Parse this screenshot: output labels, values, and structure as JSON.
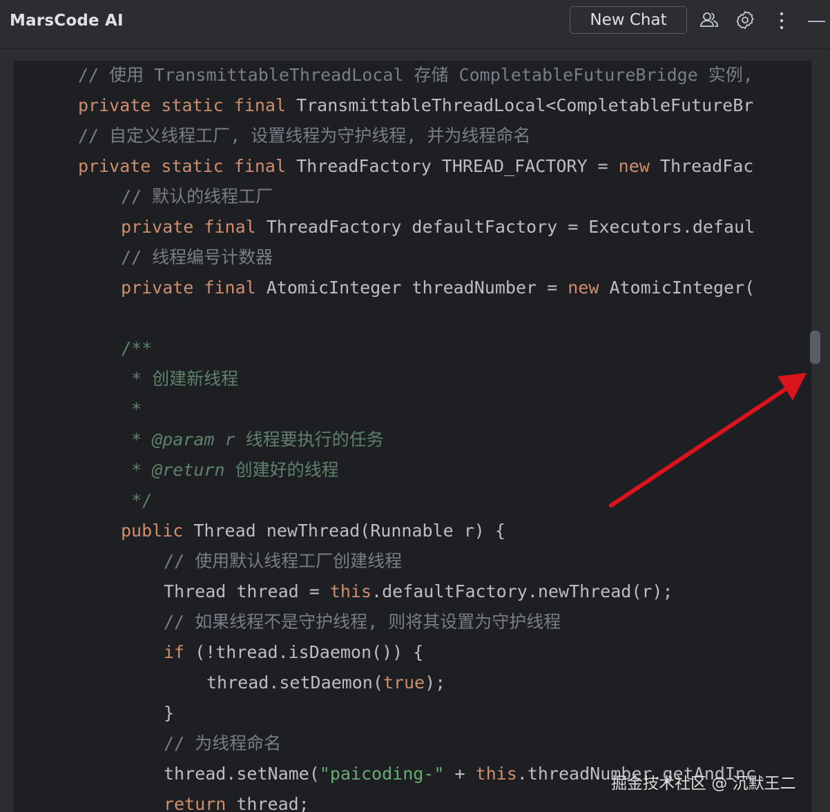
{
  "header": {
    "title": "MarsCode AI",
    "new_chat_label": "New Chat",
    "icons": [
      "users-icon",
      "gear-icon",
      "more-vertical-icon",
      "minimize-icon"
    ]
  },
  "colors": {
    "keyword": "#cf8e6d",
    "comment": "#7a7e85",
    "doc_comment": "#5f826b",
    "string": "#6aab73",
    "plain": "#bcbec4",
    "editor_bg": "#1e1f22",
    "panel_bg": "#2b2d30",
    "arrow": "#d9141c"
  },
  "code": {
    "lines": [
      {
        "indent": 0,
        "tokens": [
          {
            "c": "cm",
            "t": "// 使用 TransmittableThreadLocal 存储 CompletableFutureBridge 实例,"
          }
        ]
      },
      {
        "indent": 0,
        "tokens": [
          {
            "c": "kw",
            "t": "private static final "
          },
          {
            "c": "pl",
            "t": "TransmittableThreadLocal<CompletableFutureBr"
          }
        ]
      },
      {
        "indent": 0,
        "tokens": [
          {
            "c": "cm",
            "t": "// 自定义线程工厂, 设置线程为守护线程, 并为线程命名"
          }
        ]
      },
      {
        "indent": 0,
        "tokens": [
          {
            "c": "kw",
            "t": "private static final "
          },
          {
            "c": "pl",
            "t": "ThreadFactory THREAD_FACTORY = "
          },
          {
            "c": "kw",
            "t": "new "
          },
          {
            "c": "pl",
            "t": "ThreadFac"
          }
        ]
      },
      {
        "indent": 1,
        "tokens": [
          {
            "c": "cm",
            "t": "// 默认的线程工厂"
          }
        ]
      },
      {
        "indent": 1,
        "tokens": [
          {
            "c": "kw",
            "t": "private final "
          },
          {
            "c": "pl",
            "t": "ThreadFactory defaultFactory = Executors.defaul"
          }
        ]
      },
      {
        "indent": 1,
        "tokens": [
          {
            "c": "cm",
            "t": "// 线程编号计数器"
          }
        ]
      },
      {
        "indent": 1,
        "tokens": [
          {
            "c": "kw",
            "t": "private final "
          },
          {
            "c": "pl",
            "t": "AtomicInteger threadNumber = "
          },
          {
            "c": "kw",
            "t": "new "
          },
          {
            "c": "pl",
            "t": "AtomicInteger("
          }
        ]
      },
      {
        "indent": 1,
        "tokens": []
      },
      {
        "indent": 1,
        "tokens": [
          {
            "c": "doc",
            "t": "/**"
          }
        ]
      },
      {
        "indent": 1,
        "tokens": [
          {
            "c": "doc",
            "t": " * 创建新线程"
          }
        ]
      },
      {
        "indent": 1,
        "tokens": [
          {
            "c": "doc",
            "t": " *"
          }
        ]
      },
      {
        "indent": 1,
        "tokens": [
          {
            "c": "doc",
            "t": " * "
          },
          {
            "c": "tag",
            "t": "@param"
          },
          {
            "c": "doc",
            "t": " "
          },
          {
            "c": "prm",
            "t": "r"
          },
          {
            "c": "doc",
            "t": " 线程要执行的任务"
          }
        ]
      },
      {
        "indent": 1,
        "tokens": [
          {
            "c": "doc",
            "t": " * "
          },
          {
            "c": "tag",
            "t": "@return"
          },
          {
            "c": "doc",
            "t": " 创建好的线程"
          }
        ]
      },
      {
        "indent": 1,
        "tokens": [
          {
            "c": "doc",
            "t": " */"
          }
        ]
      },
      {
        "indent": 1,
        "tokens": [
          {
            "c": "kw",
            "t": "public "
          },
          {
            "c": "pl",
            "t": "Thread newThread(Runnable r) {"
          }
        ]
      },
      {
        "indent": 2,
        "tokens": [
          {
            "c": "cm",
            "t": "// 使用默认线程工厂创建线程"
          }
        ]
      },
      {
        "indent": 2,
        "tokens": [
          {
            "c": "pl",
            "t": "Thread thread = "
          },
          {
            "c": "kw",
            "t": "this"
          },
          {
            "c": "pl",
            "t": ".defaultFactory.newThread(r);"
          }
        ]
      },
      {
        "indent": 2,
        "tokens": [
          {
            "c": "cm",
            "t": "// 如果线程不是守护线程, 则将其设置为守护线程"
          }
        ]
      },
      {
        "indent": 2,
        "tokens": [
          {
            "c": "kw",
            "t": "if "
          },
          {
            "c": "pl",
            "t": "(!thread.isDaemon()) {"
          }
        ]
      },
      {
        "indent": 3,
        "tokens": [
          {
            "c": "pl",
            "t": "thread.setDaemon("
          },
          {
            "c": "kw",
            "t": "true"
          },
          {
            "c": "pl",
            "t": ");"
          }
        ]
      },
      {
        "indent": 2,
        "tokens": [
          {
            "c": "pl",
            "t": "}"
          }
        ]
      },
      {
        "indent": 2,
        "tokens": [
          {
            "c": "cm",
            "t": "// 为线程命名"
          }
        ]
      },
      {
        "indent": 2,
        "tokens": [
          {
            "c": "pl",
            "t": "thread.setName("
          },
          {
            "c": "str",
            "t": "\"paicoding-\""
          },
          {
            "c": "pl",
            "t": " + "
          },
          {
            "c": "kw",
            "t": "this"
          },
          {
            "c": "pl",
            "t": ".threadNumber.getAndInc"
          }
        ]
      },
      {
        "indent": 2,
        "tokens": [
          {
            "c": "kw",
            "t": "return "
          },
          {
            "c": "pl",
            "t": "thread;"
          }
        ]
      }
    ]
  },
  "watermark": "掘金技术社区 @ 沉默王二"
}
